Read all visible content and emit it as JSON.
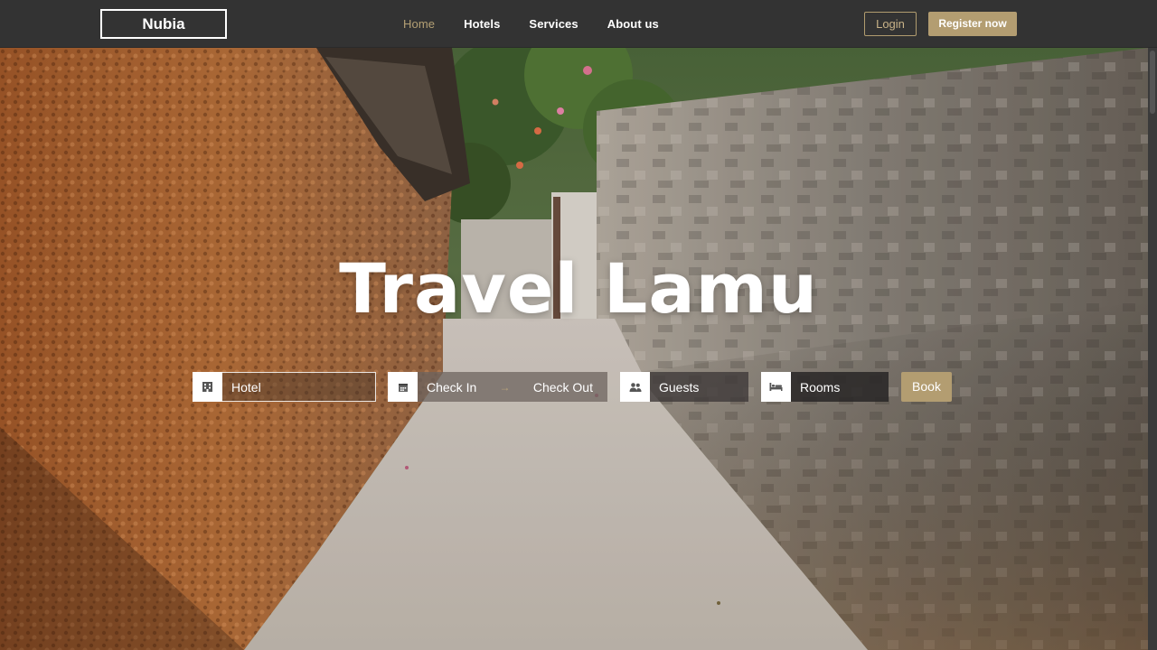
{
  "nav": {
    "brand": "Nubia",
    "links": [
      "Home",
      "Hotels",
      "Services",
      "About us"
    ],
    "active_index": 0,
    "login": "Login",
    "register": "Register now"
  },
  "hero": {
    "title": "Travel Lamu"
  },
  "booking": {
    "hotel_placeholder": "Hotel",
    "check_in": "Check In",
    "arrow": "→",
    "check_out": "Check Out",
    "guests": "Guests",
    "rooms": "Rooms",
    "book": "Book"
  },
  "icons": {
    "hotel": "building-icon",
    "dates": "calendar-icon",
    "guests": "users-icon",
    "rooms": "bed-icon"
  },
  "colors": {
    "accent": "#b39d71",
    "navbar": "#333333"
  }
}
